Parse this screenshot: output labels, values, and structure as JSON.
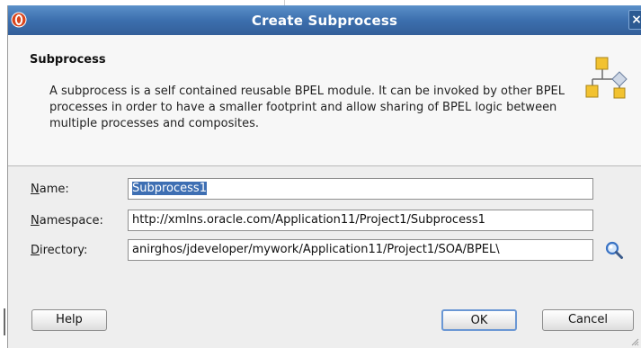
{
  "dialog": {
    "title": "Create Subprocess",
    "close_label": "×"
  },
  "header": {
    "title": "Subprocess",
    "description": "A subprocess is a self contained reusable BPEL module. It can be invoked by other BPEL processes in order to have a smaller footprint and allow sharing of BPEL logic between multiple processes and composites."
  },
  "form": {
    "name": {
      "label_mnemonic": "N",
      "label_rest": "ame:",
      "value": "Subprocess1"
    },
    "namespace": {
      "label_mnemonic": "N",
      "label_rest": "amespace:",
      "value": "http://xmlns.oracle.com/Application11/Project1/Subprocess1"
    },
    "directory": {
      "label_mnemonic": "D",
      "label_rest": "irectory:",
      "value": "\\anirghos/jdeveloper/mywork/Application11/Project1/SOA/BPEL"
    }
  },
  "buttons": {
    "help": "Help",
    "ok": "OK",
    "cancel": "Cancel"
  },
  "icons": {
    "app": "oracle-jdeveloper-icon",
    "header": "subprocess-hierarchy-icon",
    "browse": "magnifier-search-icon"
  },
  "colors": {
    "titlebar": "#3c6fae",
    "selection": "#3e6fb3",
    "icon_yellow": "#f2c230"
  }
}
